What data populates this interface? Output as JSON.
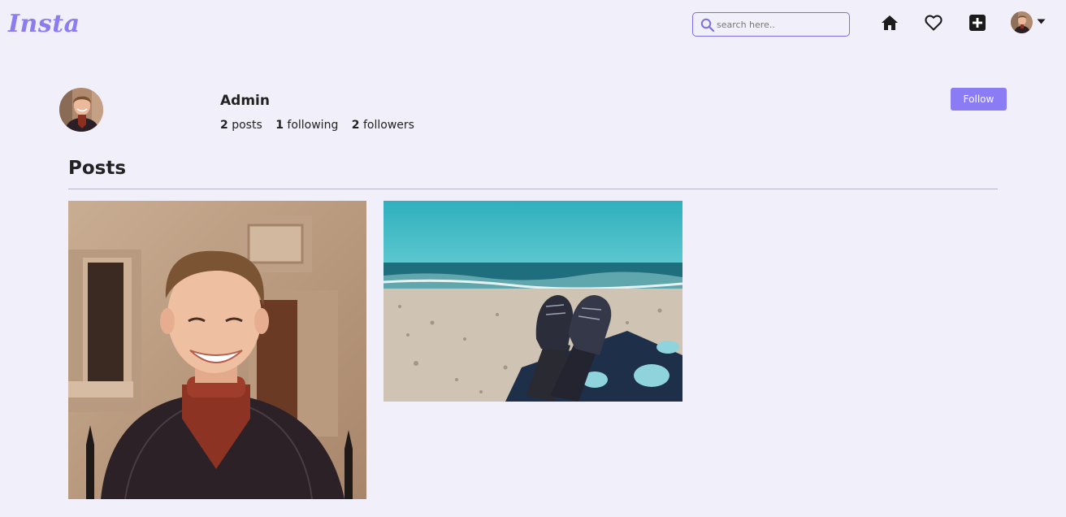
{
  "navbar": {
    "logo": "Insta",
    "search": {
      "placeholder": "search here.."
    },
    "icons": [
      "home-icon",
      "heart-icon",
      "plus-square-icon",
      "user-avatar",
      "caret-down-icon"
    ]
  },
  "profile": {
    "username": "Admin",
    "stats": {
      "posts_count": "2",
      "posts_label": "posts",
      "following_count": "1",
      "following_label": "following",
      "followers_count": "2",
      "followers_label": "followers"
    },
    "follow_label": "Follow"
  },
  "posts_section": {
    "title": "Posts"
  },
  "posts": [
    {
      "image": "portrait of smiling man in pinstripe suit"
    },
    {
      "image": "feet in boots on pebble beach by the sea"
    }
  ],
  "colors": {
    "accent": "#8b7cf6",
    "background": "#f0effa",
    "text": "#212529"
  }
}
